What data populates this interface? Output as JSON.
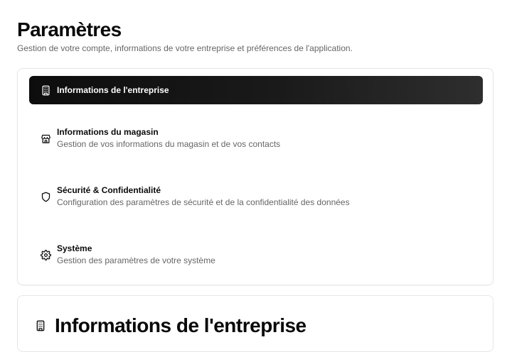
{
  "header": {
    "title": "Paramètres",
    "subtitle": "Gestion de votre compte, informations de votre entreprise et préférences de l'application."
  },
  "nav": {
    "items": [
      {
        "label": "Informations de l'entreprise",
        "description": "",
        "icon": "building-icon",
        "active": true
      },
      {
        "label": "Informations du magasin",
        "description": "Gestion de vos informations du magasin et de vos contacts",
        "icon": "store-icon",
        "active": false
      },
      {
        "label": "Sécurité & Confidentialité",
        "description": "Configuration des paramètres de sécurité et de la confidentialité des données",
        "icon": "shield-icon",
        "active": false
      },
      {
        "label": "Système",
        "description": "Gestion des paramètres de votre système",
        "icon": "gear-icon",
        "active": false
      }
    ]
  },
  "section": {
    "title": "Informations de l'entreprise",
    "icon": "building-icon"
  },
  "colors": {
    "active_bg": "#111111",
    "text": "#0a0a0a",
    "muted_text": "#666666",
    "border": "#e6e6e6"
  }
}
